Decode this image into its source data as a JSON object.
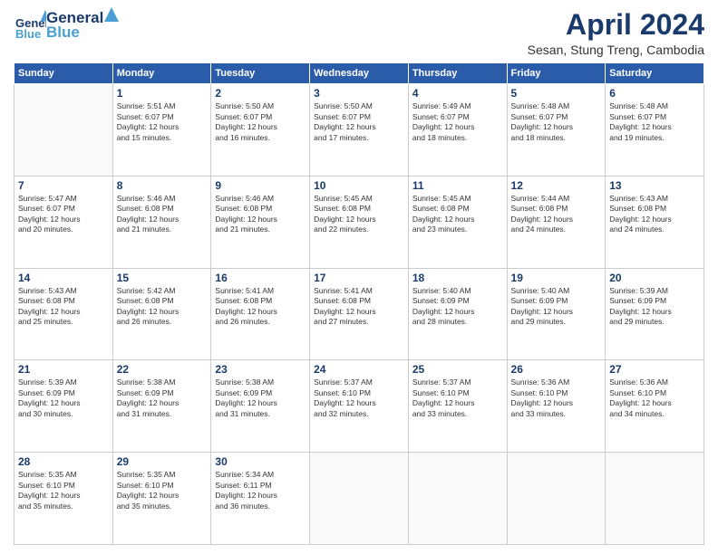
{
  "header": {
    "logo_line1": "General",
    "logo_line2": "Blue",
    "title": "April 2024",
    "subtitle": "Sesan, Stung Treng, Cambodia"
  },
  "calendar": {
    "days_of_week": [
      "Sunday",
      "Monday",
      "Tuesday",
      "Wednesday",
      "Thursday",
      "Friday",
      "Saturday"
    ],
    "weeks": [
      [
        {
          "day": "",
          "lines": []
        },
        {
          "day": "1",
          "lines": [
            "Sunrise: 5:51 AM",
            "Sunset: 6:07 PM",
            "Daylight: 12 hours",
            "and 15 minutes."
          ]
        },
        {
          "day": "2",
          "lines": [
            "Sunrise: 5:50 AM",
            "Sunset: 6:07 PM",
            "Daylight: 12 hours",
            "and 16 minutes."
          ]
        },
        {
          "day": "3",
          "lines": [
            "Sunrise: 5:50 AM",
            "Sunset: 6:07 PM",
            "Daylight: 12 hours",
            "and 17 minutes."
          ]
        },
        {
          "day": "4",
          "lines": [
            "Sunrise: 5:49 AM",
            "Sunset: 6:07 PM",
            "Daylight: 12 hours",
            "and 18 minutes."
          ]
        },
        {
          "day": "5",
          "lines": [
            "Sunrise: 5:48 AM",
            "Sunset: 6:07 PM",
            "Daylight: 12 hours",
            "and 18 minutes."
          ]
        },
        {
          "day": "6",
          "lines": [
            "Sunrise: 5:48 AM",
            "Sunset: 6:07 PM",
            "Daylight: 12 hours",
            "and 19 minutes."
          ]
        }
      ],
      [
        {
          "day": "7",
          "lines": [
            "Sunrise: 5:47 AM",
            "Sunset: 6:07 PM",
            "Daylight: 12 hours",
            "and 20 minutes."
          ]
        },
        {
          "day": "8",
          "lines": [
            "Sunrise: 5:46 AM",
            "Sunset: 6:08 PM",
            "Daylight: 12 hours",
            "and 21 minutes."
          ]
        },
        {
          "day": "9",
          "lines": [
            "Sunrise: 5:46 AM",
            "Sunset: 6:08 PM",
            "Daylight: 12 hours",
            "and 21 minutes."
          ]
        },
        {
          "day": "10",
          "lines": [
            "Sunrise: 5:45 AM",
            "Sunset: 6:08 PM",
            "Daylight: 12 hours",
            "and 22 minutes."
          ]
        },
        {
          "day": "11",
          "lines": [
            "Sunrise: 5:45 AM",
            "Sunset: 6:08 PM",
            "Daylight: 12 hours",
            "and 23 minutes."
          ]
        },
        {
          "day": "12",
          "lines": [
            "Sunrise: 5:44 AM",
            "Sunset: 6:08 PM",
            "Daylight: 12 hours",
            "and 24 minutes."
          ]
        },
        {
          "day": "13",
          "lines": [
            "Sunrise: 5:43 AM",
            "Sunset: 6:08 PM",
            "Daylight: 12 hours",
            "and 24 minutes."
          ]
        }
      ],
      [
        {
          "day": "14",
          "lines": [
            "Sunrise: 5:43 AM",
            "Sunset: 6:08 PM",
            "Daylight: 12 hours",
            "and 25 minutes."
          ]
        },
        {
          "day": "15",
          "lines": [
            "Sunrise: 5:42 AM",
            "Sunset: 6:08 PM",
            "Daylight: 12 hours",
            "and 26 minutes."
          ]
        },
        {
          "day": "16",
          "lines": [
            "Sunrise: 5:41 AM",
            "Sunset: 6:08 PM",
            "Daylight: 12 hours",
            "and 26 minutes."
          ]
        },
        {
          "day": "17",
          "lines": [
            "Sunrise: 5:41 AM",
            "Sunset: 6:08 PM",
            "Daylight: 12 hours",
            "and 27 minutes."
          ]
        },
        {
          "day": "18",
          "lines": [
            "Sunrise: 5:40 AM",
            "Sunset: 6:09 PM",
            "Daylight: 12 hours",
            "and 28 minutes."
          ]
        },
        {
          "day": "19",
          "lines": [
            "Sunrise: 5:40 AM",
            "Sunset: 6:09 PM",
            "Daylight: 12 hours",
            "and 29 minutes."
          ]
        },
        {
          "day": "20",
          "lines": [
            "Sunrise: 5:39 AM",
            "Sunset: 6:09 PM",
            "Daylight: 12 hours",
            "and 29 minutes."
          ]
        }
      ],
      [
        {
          "day": "21",
          "lines": [
            "Sunrise: 5:39 AM",
            "Sunset: 6:09 PM",
            "Daylight: 12 hours",
            "and 30 minutes."
          ]
        },
        {
          "day": "22",
          "lines": [
            "Sunrise: 5:38 AM",
            "Sunset: 6:09 PM",
            "Daylight: 12 hours",
            "and 31 minutes."
          ]
        },
        {
          "day": "23",
          "lines": [
            "Sunrise: 5:38 AM",
            "Sunset: 6:09 PM",
            "Daylight: 12 hours",
            "and 31 minutes."
          ]
        },
        {
          "day": "24",
          "lines": [
            "Sunrise: 5:37 AM",
            "Sunset: 6:10 PM",
            "Daylight: 12 hours",
            "and 32 minutes."
          ]
        },
        {
          "day": "25",
          "lines": [
            "Sunrise: 5:37 AM",
            "Sunset: 6:10 PM",
            "Daylight: 12 hours",
            "and 33 minutes."
          ]
        },
        {
          "day": "26",
          "lines": [
            "Sunrise: 5:36 AM",
            "Sunset: 6:10 PM",
            "Daylight: 12 hours",
            "and 33 minutes."
          ]
        },
        {
          "day": "27",
          "lines": [
            "Sunrise: 5:36 AM",
            "Sunset: 6:10 PM",
            "Daylight: 12 hours",
            "and 34 minutes."
          ]
        }
      ],
      [
        {
          "day": "28",
          "lines": [
            "Sunrise: 5:35 AM",
            "Sunset: 6:10 PM",
            "Daylight: 12 hours",
            "and 35 minutes."
          ]
        },
        {
          "day": "29",
          "lines": [
            "Sunrise: 5:35 AM",
            "Sunset: 6:10 PM",
            "Daylight: 12 hours",
            "and 35 minutes."
          ]
        },
        {
          "day": "30",
          "lines": [
            "Sunrise: 5:34 AM",
            "Sunset: 6:11 PM",
            "Daylight: 12 hours",
            "and 36 minutes."
          ]
        },
        {
          "day": "",
          "lines": []
        },
        {
          "day": "",
          "lines": []
        },
        {
          "day": "",
          "lines": []
        },
        {
          "day": "",
          "lines": []
        }
      ]
    ]
  }
}
